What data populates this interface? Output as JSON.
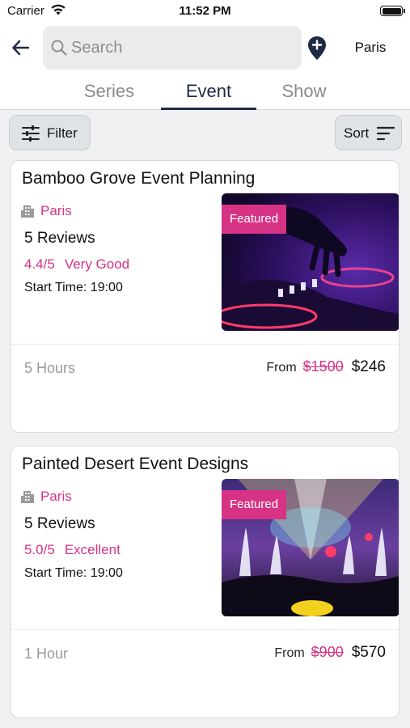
{
  "status_bar": {
    "carrier": "Carrier",
    "time": "11:52 PM"
  },
  "header": {
    "search_placeholder": "Search",
    "city": "Paris"
  },
  "tabs": [
    {
      "label": "Series",
      "active": false
    },
    {
      "label": "Event",
      "active": true
    },
    {
      "label": "Show",
      "active": false
    }
  ],
  "toolbar": {
    "filter_label": "Filter",
    "sort_label": "Sort"
  },
  "colors": {
    "accent": "#d63384",
    "tab_active": "#1f2a44"
  },
  "events": [
    {
      "title": "Bamboo Grove Event Planning",
      "city": "Paris",
      "reviews": "5 Reviews",
      "rating": "4.4/5",
      "rating_label": "Very Good",
      "start_time": "Start Time: 19:00",
      "badge": "Featured",
      "duration": "5 Hours",
      "from_label": "From",
      "old_price": "$1500",
      "new_price": "$246"
    },
    {
      "title": "Painted Desert Event Designs",
      "city": "Paris",
      "reviews": "5 Reviews",
      "rating": "5.0/5",
      "rating_label": "Excellent",
      "start_time": "Start Time: 19:00",
      "badge": "Featured",
      "duration": "1 Hour",
      "from_label": "From",
      "old_price": "$900",
      "new_price": "$570"
    }
  ]
}
